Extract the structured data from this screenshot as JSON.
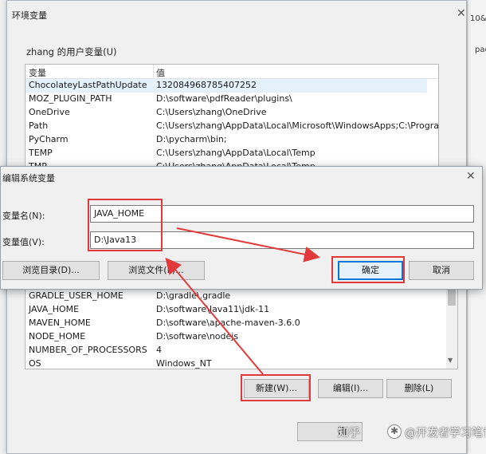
{
  "env_window": {
    "title": "环境变量",
    "close_glyph": "✕",
    "user_group_label": "zhang 的用户变量(U)",
    "user_list": {
      "col_name": "变量",
      "col_value": "值",
      "rows": [
        {
          "name": "ChocolateyLastPathUpdate",
          "value": "132084968785407252"
        },
        {
          "name": "MOZ_PLUGIN_PATH",
          "value": "D:\\software\\pdfReader\\plugins\\"
        },
        {
          "name": "OneDrive",
          "value": "C:\\Users\\zhang\\OneDrive"
        },
        {
          "name": "Path",
          "value": "C:\\Users\\zhang\\AppData\\Local\\Microsoft\\WindowsApps;C:\\Progra..."
        },
        {
          "name": "PyCharm",
          "value": "D:\\pycharm\\bin;"
        },
        {
          "name": "TEMP",
          "value": "C:\\Users\\zhang\\AppData\\Local\\Temp"
        },
        {
          "name": "TMP",
          "value": "C:\\Users\\zhang\\AppData\\Local\\Temp"
        }
      ]
    },
    "system_list": {
      "rows": [
        {
          "name": "GRADLE_USER_HOME",
          "value": "D:\\gradle\\.gradle"
        },
        {
          "name": "JAVA_HOME",
          "value": "D:\\software\\Java11\\jdk-11"
        },
        {
          "name": "MAVEN_HOME",
          "value": "D:\\software\\apache-maven-3.6.0"
        },
        {
          "name": "NODE_HOME",
          "value": "D:\\software\\nodejs"
        },
        {
          "name": "NUMBER_OF_PROCESSORS",
          "value": "4"
        },
        {
          "name": "OS",
          "value": "Windows_NT"
        }
      ]
    },
    "buttons": {
      "new": "新建(W)...",
      "edit": "编辑(I)...",
      "delete": "删除(L)",
      "ok": "确"
    }
  },
  "edit_dialog": {
    "title": "编辑系统变量",
    "close_glyph": "✕",
    "name_label": "变量名(N):",
    "name_value": "JAVA_HOME",
    "value_label": "变量值(V):",
    "value_value": "D:\\Java13",
    "browse_dir": "浏览目录(D)...",
    "browse_file": "浏览文件(F)...",
    "ok": "确定",
    "cancel": "取消"
  },
  "background": {
    "right_text_1": "10&&",
    "right_text_2": "pac"
  },
  "watermark": {
    "text_1": "知乎",
    "text_2": "@开发者学习笔记"
  },
  "colors": {
    "highlight": "#e2393a",
    "accent": "#0078d7",
    "selection": "#e5f1fb"
  }
}
